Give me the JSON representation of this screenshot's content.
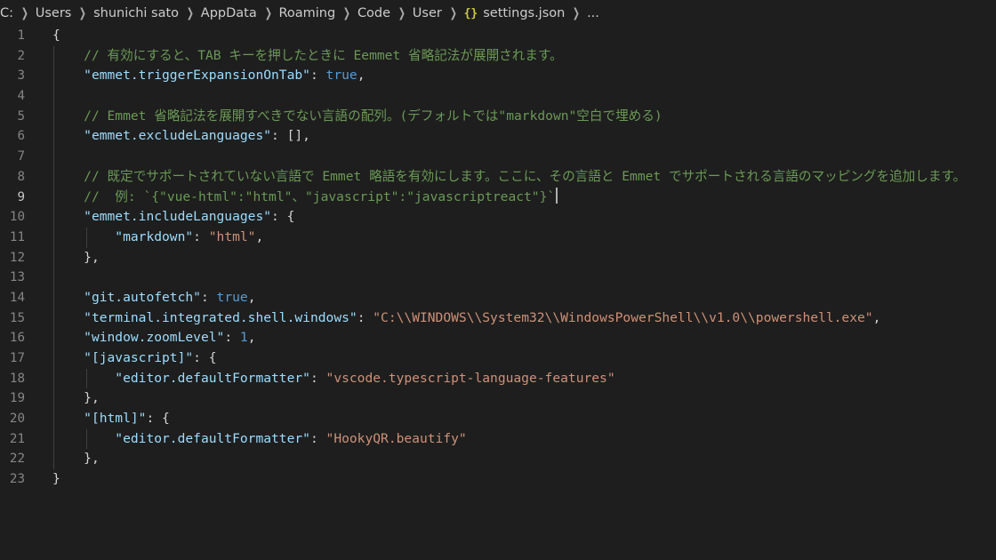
{
  "breadcrumb": {
    "segments": [
      "C:",
      "Users",
      "shunichi sato",
      "AppData",
      "Roaming",
      "Code",
      "User"
    ],
    "file_icon": "{}",
    "file_name": "settings.json",
    "trailing": "..."
  },
  "editor": {
    "active_line": 9,
    "colors": {
      "background": "#1e1e1e",
      "key": "#9cdcfe",
      "string": "#ce9178",
      "keyword": "#569cd6",
      "comment": "#6a9955",
      "punctuation": "#d4d4d4",
      "line_number": "#858585"
    },
    "lines": [
      {
        "number": "1",
        "indent": 0,
        "tokens": [
          {
            "t": "brace",
            "v": "{"
          }
        ]
      },
      {
        "number": "2",
        "indent": 1,
        "tokens": [
          {
            "t": "cmt",
            "v": "// 有効にすると、TAB キーを押したときに Eemmet 省略記法が展開されます。"
          }
        ]
      },
      {
        "number": "3",
        "indent": 1,
        "tokens": [
          {
            "t": "key",
            "v": "\"emmet.triggerExpansionOnTab\""
          },
          {
            "t": "punc",
            "v": ": "
          },
          {
            "t": "bool",
            "v": "true"
          },
          {
            "t": "punc",
            "v": ","
          }
        ]
      },
      {
        "number": "4",
        "indent": 1,
        "tokens": []
      },
      {
        "number": "5",
        "indent": 1,
        "tokens": [
          {
            "t": "cmt",
            "v": "// Emmet 省略記法を展開すべきでない言語の配列。(デフォルトでは\"markdown\"空白で埋める)"
          }
        ]
      },
      {
        "number": "6",
        "indent": 1,
        "tokens": [
          {
            "t": "key",
            "v": "\"emmet.excludeLanguages\""
          },
          {
            "t": "punc",
            "v": ": [],"
          }
        ]
      },
      {
        "number": "7",
        "indent": 1,
        "tokens": []
      },
      {
        "number": "8",
        "indent": 1,
        "tokens": [
          {
            "t": "cmt",
            "v": "// 既定でサポートされていない言語で Emmet 略語を有効にします。ここに、その言語と Emmet でサポートされる言語のマッピングを追加します。"
          }
        ]
      },
      {
        "number": "9",
        "indent": 1,
        "cursor": true,
        "tokens": [
          {
            "t": "cmt",
            "v": "//  例: `{\"vue-html\":\"html\"、\"javascript\":\"javascriptreact\"}`"
          }
        ]
      },
      {
        "number": "10",
        "indent": 1,
        "tokens": [
          {
            "t": "key",
            "v": "\"emmet.includeLanguages\""
          },
          {
            "t": "punc",
            "v": ": {"
          }
        ]
      },
      {
        "number": "11",
        "indent": 2,
        "tokens": [
          {
            "t": "key",
            "v": "\"markdown\""
          },
          {
            "t": "punc",
            "v": ": "
          },
          {
            "t": "str",
            "v": "\"html\""
          },
          {
            "t": "punc",
            "v": ","
          }
        ]
      },
      {
        "number": "12",
        "indent": 1,
        "tokens": [
          {
            "t": "punc",
            "v": "},"
          }
        ]
      },
      {
        "number": "13",
        "indent": 1,
        "tokens": []
      },
      {
        "number": "14",
        "indent": 1,
        "tokens": [
          {
            "t": "key",
            "v": "\"git.autofetch\""
          },
          {
            "t": "punc",
            "v": ": "
          },
          {
            "t": "bool",
            "v": "true"
          },
          {
            "t": "punc",
            "v": ","
          }
        ]
      },
      {
        "number": "15",
        "indent": 1,
        "tokens": [
          {
            "t": "key",
            "v": "\"terminal.integrated.shell.windows\""
          },
          {
            "t": "punc",
            "v": ": "
          },
          {
            "t": "str",
            "v": "\"C:\\\\WINDOWS\\\\System32\\\\WindowsPowerShell\\\\v1.0\\\\powershell.exe\""
          },
          {
            "t": "punc",
            "v": ","
          }
        ]
      },
      {
        "number": "16",
        "indent": 1,
        "tokens": [
          {
            "t": "key",
            "v": "\"window.zoomLevel\""
          },
          {
            "t": "punc",
            "v": ": "
          },
          {
            "t": "bool",
            "v": "1"
          },
          {
            "t": "punc",
            "v": ","
          }
        ]
      },
      {
        "number": "17",
        "indent": 1,
        "tokens": [
          {
            "t": "key",
            "v": "\"[javascript]\""
          },
          {
            "t": "punc",
            "v": ": {"
          }
        ]
      },
      {
        "number": "18",
        "indent": 2,
        "tokens": [
          {
            "t": "key",
            "v": "\"editor.defaultFormatter\""
          },
          {
            "t": "punc",
            "v": ": "
          },
          {
            "t": "str",
            "v": "\"vscode.typescript-language-features\""
          }
        ]
      },
      {
        "number": "19",
        "indent": 1,
        "tokens": [
          {
            "t": "punc",
            "v": "},"
          }
        ]
      },
      {
        "number": "20",
        "indent": 1,
        "tokens": [
          {
            "t": "key",
            "v": "\"[html]\""
          },
          {
            "t": "punc",
            "v": ": {"
          }
        ]
      },
      {
        "number": "21",
        "indent": 2,
        "tokens": [
          {
            "t": "key",
            "v": "\"editor.defaultFormatter\""
          },
          {
            "t": "punc",
            "v": ": "
          },
          {
            "t": "str",
            "v": "\"HookyQR.beautify\""
          }
        ]
      },
      {
        "number": "22",
        "indent": 1,
        "tokens": [
          {
            "t": "punc",
            "v": "},"
          }
        ]
      },
      {
        "number": "23",
        "indent": 0,
        "tokens": [
          {
            "t": "brace",
            "v": "}"
          }
        ]
      }
    ]
  }
}
